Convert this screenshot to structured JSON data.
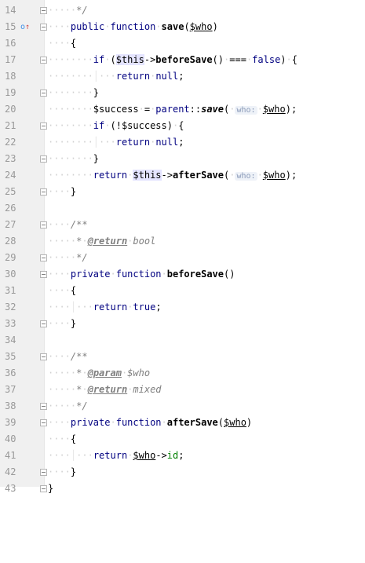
{
  "editor": {
    "lines": [
      {
        "n": "14"
      },
      {
        "n": "15"
      },
      {
        "n": "16"
      },
      {
        "n": "17"
      },
      {
        "n": "18"
      },
      {
        "n": "19"
      },
      {
        "n": "20"
      },
      {
        "n": "21"
      },
      {
        "n": "22"
      },
      {
        "n": "23"
      },
      {
        "n": "24"
      },
      {
        "n": "25"
      },
      {
        "n": "26"
      },
      {
        "n": "27"
      },
      {
        "n": "28"
      },
      {
        "n": "29"
      },
      {
        "n": "30"
      },
      {
        "n": "31"
      },
      {
        "n": "32"
      },
      {
        "n": "33"
      },
      {
        "n": "34"
      },
      {
        "n": "35"
      },
      {
        "n": "36"
      },
      {
        "n": "37"
      },
      {
        "n": "38"
      },
      {
        "n": "39"
      },
      {
        "n": "40"
      },
      {
        "n": "41"
      },
      {
        "n": "42"
      },
      {
        "n": "43"
      }
    ],
    "markers": {
      "override_marker": "o↑"
    },
    "tokens": {
      "comment_close": "*/",
      "comment_open": "/**",
      "comment_star": "*",
      "public": "public",
      "private": "private",
      "function": "function",
      "save": "save",
      "beforeSave": "beforeSave",
      "afterSave": "afterSave",
      "who": "$who",
      "this": "$this",
      "arrow": "->",
      "dcolon": "::",
      "if": "if",
      "return": "return",
      "null": "null",
      "true": "true",
      "false": "false",
      "triple_eq": "===",
      "parent": "parent",
      "success": "$success",
      "eq": "=",
      "not": "!",
      "lparen": "(",
      "rparen": ")",
      "lbrace": "{",
      "rbrace": "}",
      "semi": ";",
      "hint_who": "who:",
      "tag_return": "@return",
      "tag_param": "@param",
      "bool": "bool",
      "mixed": "mixed",
      "id": "id"
    }
  }
}
